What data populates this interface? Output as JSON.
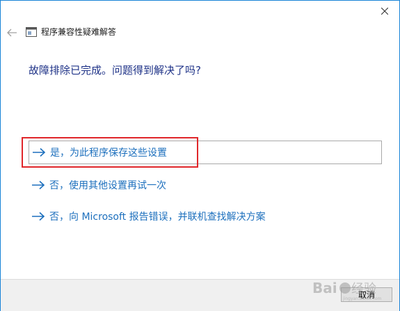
{
  "window": {
    "title": "程序兼容性疑难解答",
    "close_icon": "close-icon",
    "back_icon": "back-arrow-icon"
  },
  "main": {
    "question": "故障排除已完成。问题得到解决了吗?",
    "options": [
      {
        "label": "是，为此程序保存这些设置",
        "icon": "arrow-right-icon"
      },
      {
        "label": "否，使用其他设置再试一次",
        "icon": "arrow-right-icon"
      },
      {
        "label": "否，向 Microsoft 报告错误，并联机查找解决方案",
        "icon": "arrow-right-icon"
      }
    ]
  },
  "footer": {
    "cancel_label": "取消"
  },
  "colors": {
    "accent": "#1c6fbd",
    "question": "#1e3287",
    "highlight": "#e0262a",
    "border": "#1883d7"
  }
}
